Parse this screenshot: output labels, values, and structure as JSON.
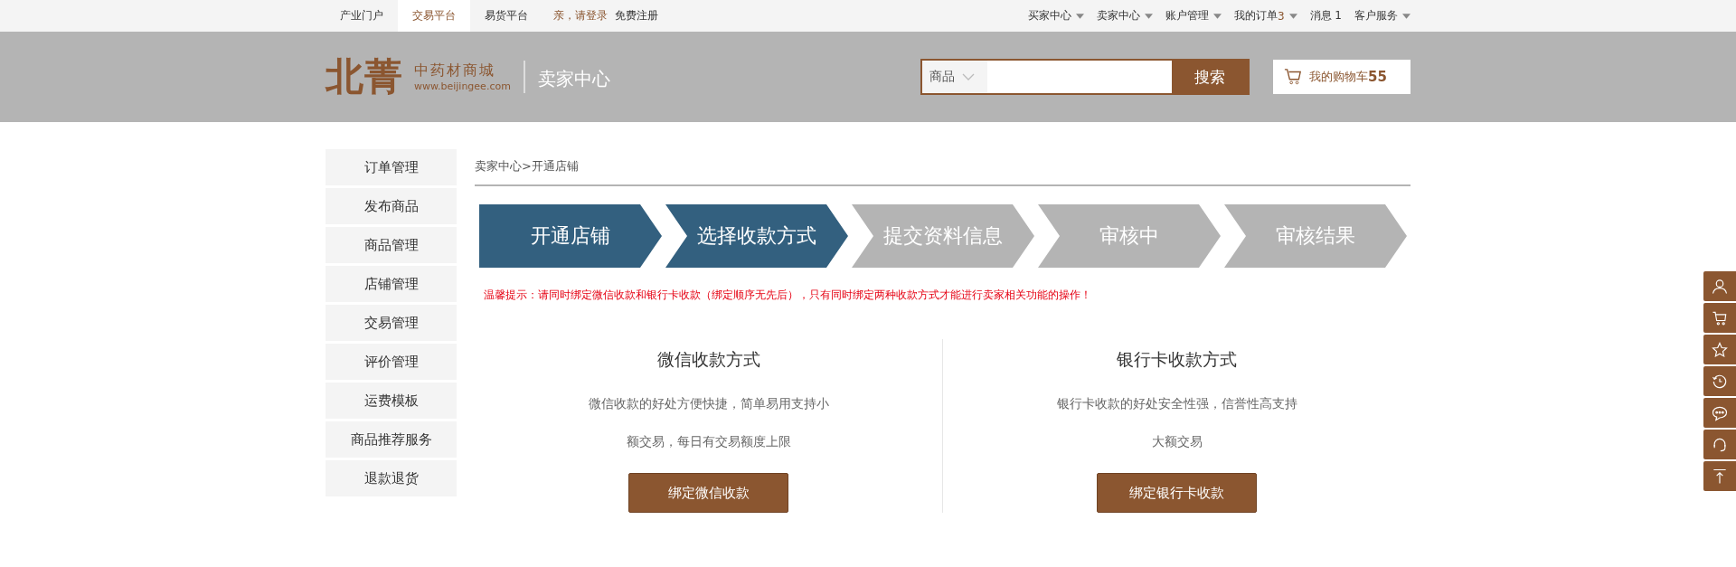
{
  "top_nav": {
    "links": [
      {
        "label": "产业门户",
        "selected": false
      },
      {
        "label": "交易平台",
        "selected": true
      },
      {
        "label": "易货平台",
        "selected": false
      }
    ],
    "login": "亲，请登录",
    "register": "免费注册",
    "menus": [
      {
        "label": "买家中心",
        "dropdown": true
      },
      {
        "label": "卖家中心",
        "dropdown": true
      },
      {
        "label": "账户管理",
        "dropdown": true
      },
      {
        "label": "我的订单",
        "count": "3",
        "dropdown": true
      },
      {
        "label": "消息 1",
        "dropdown": false
      },
      {
        "label": "客户服务",
        "dropdown": true
      }
    ]
  },
  "header": {
    "logo": "北菁",
    "logo_name": "中药材商城",
    "logo_url": "www.beijingee.com",
    "section": "卖家中心",
    "search": {
      "category": "商品",
      "button": "搜索"
    },
    "cart": {
      "label": "我的购物车",
      "count": "55"
    }
  },
  "sidebar": {
    "items": [
      "订单管理",
      "发布商品",
      "商品管理",
      "店铺管理",
      "交易管理",
      "评价管理",
      "运费模板",
      "商品推荐服务",
      "退款退货"
    ]
  },
  "breadcrumb": "卖家中心>开通店铺",
  "steps": [
    {
      "label": "开通店铺",
      "done": true
    },
    {
      "label": "选择收款方式",
      "done": true
    },
    {
      "label": "提交资料信息",
      "done": false
    },
    {
      "label": "审核中",
      "done": false
    },
    {
      "label": "审核结果",
      "done": false
    }
  ],
  "notice": "温馨提示：请同时绑定微信收款和银行卡收款（绑定顺序无先后），只有同时绑定两种收款方式才能进行卖家相关功能的操作！",
  "methods": [
    {
      "title": "微信收款方式",
      "lines": [
        "微信收款的好处方便快捷，简单易用支持小",
        "额交易，每日有交易额度上限"
      ],
      "button": "绑定微信收款"
    },
    {
      "title": "银行卡收款方式",
      "lines": [
        "银行卡收款的好处安全性强，信誉性高支持",
        "大额交易"
      ],
      "button": "绑定银行卡收款"
    }
  ],
  "side_tools": [
    {
      "kind": "user"
    },
    {
      "kind": "cart"
    },
    {
      "kind": "star"
    },
    {
      "kind": "history"
    },
    {
      "kind": "chat"
    },
    {
      "kind": "service"
    },
    {
      "kind": "top"
    }
  ]
}
